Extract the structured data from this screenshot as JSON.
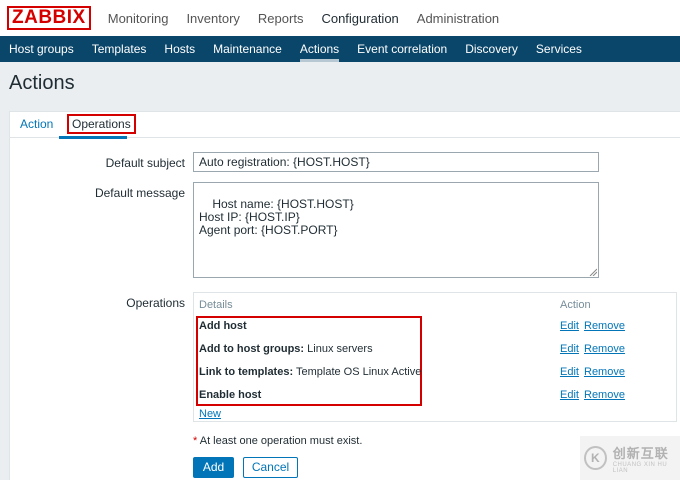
{
  "app": {
    "logo": "ZABBIX"
  },
  "top_menu": [
    {
      "label": "Monitoring"
    },
    {
      "label": "Inventory"
    },
    {
      "label": "Reports"
    },
    {
      "label": "Configuration",
      "active": true
    },
    {
      "label": "Administration"
    }
  ],
  "sub_nav": [
    {
      "label": "Host groups"
    },
    {
      "label": "Templates"
    },
    {
      "label": "Hosts"
    },
    {
      "label": "Maintenance"
    },
    {
      "label": "Actions",
      "active": true
    },
    {
      "label": "Event correlation"
    },
    {
      "label": "Discovery"
    },
    {
      "label": "Services"
    }
  ],
  "page": {
    "title": "Actions"
  },
  "tabs": {
    "action": "Action",
    "operations": "Operations"
  },
  "form": {
    "default_subject_label": "Default subject",
    "default_subject_value": "Auto registration: {HOST.HOST}",
    "default_message_label": "Default message",
    "default_message_value": "Host name: {HOST.HOST}\nHost IP: {HOST.IP}\nAgent port: {HOST.PORT}",
    "operations_label": "Operations"
  },
  "operations": {
    "header_details": "Details",
    "header_action": "Action",
    "rows": [
      {
        "bold": "Add host",
        "rest": "",
        "edit": "Edit",
        "remove": "Remove"
      },
      {
        "bold": "Add to host groups:",
        "rest": " Linux servers",
        "edit": "Edit",
        "remove": "Remove"
      },
      {
        "bold": "Link to templates:",
        "rest": " Template OS Linux Active",
        "edit": "Edit",
        "remove": "Remove"
      },
      {
        "bold": "Enable host",
        "rest": "",
        "edit": "Edit",
        "remove": "Remove"
      }
    ],
    "new_link": "New"
  },
  "note": {
    "star": "*",
    "text": " At least one operation must exist."
  },
  "buttons": {
    "add": "Add",
    "cancel": "Cancel"
  },
  "watermark": {
    "icon_text": "K",
    "main": "创新互联",
    "sub": "CHUANG XIN HU LIAN"
  },
  "colors": {
    "brand_red": "#d40000",
    "nav_bg": "#0a466a",
    "link_blue": "#0275b8"
  }
}
